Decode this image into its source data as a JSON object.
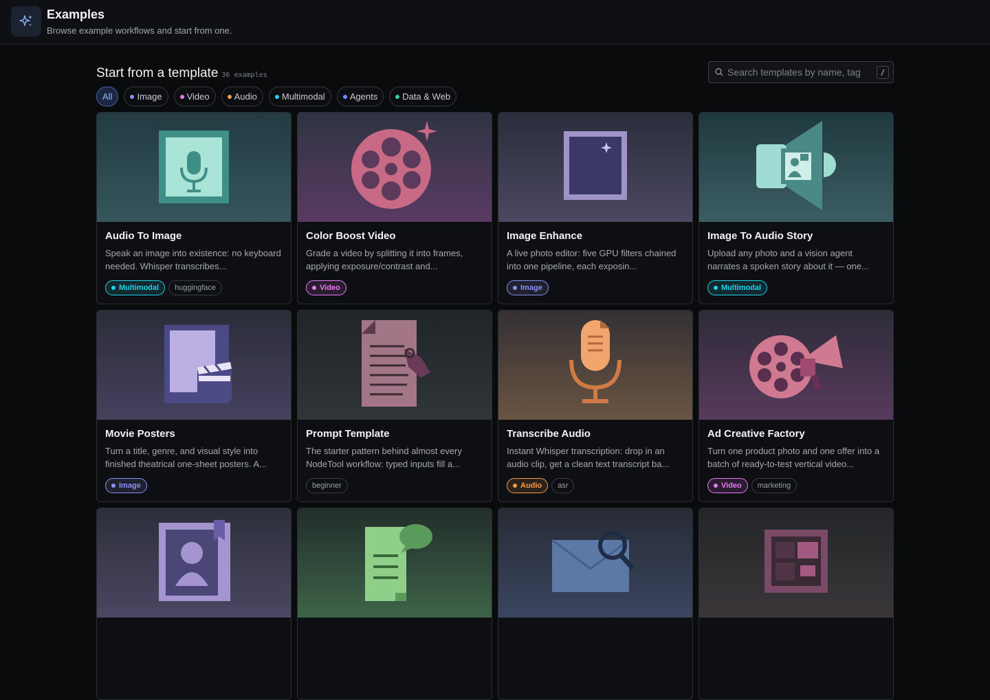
{
  "header": {
    "title": "Examples",
    "subtitle": "Browse example workflows and start from one."
  },
  "section": {
    "title": "Start from a template",
    "count": "36 examples"
  },
  "search": {
    "placeholder": "Search templates by name, tag",
    "shortcut": "/"
  },
  "filters": [
    {
      "label": "All",
      "color": ""
    },
    {
      "label": "Image",
      "color": "#8b8ef5"
    },
    {
      "label": "Video",
      "color": "#e879f9"
    },
    {
      "label": "Audio",
      "color": "#f59e4a"
    },
    {
      "label": "Multimodal",
      "color": "#22d3ee"
    },
    {
      "label": "Agents",
      "color": "#6b8cff"
    },
    {
      "label": "Data & Web",
      "color": "#34d399"
    }
  ],
  "templates": [
    {
      "title": "Audio To Image",
      "description": "Speak an image into existence: no keyboard needed. Whisper transcribes...",
      "category": "Multimodal",
      "tags": [
        "huggingface"
      ],
      "icon": "microphone-image-icon"
    },
    {
      "title": "Color Boost Video",
      "description": "Grade a video by splitting it into frames, applying exposure/contrast and...",
      "category": "Video",
      "tags": [],
      "icon": "film-reel-icon"
    },
    {
      "title": "Image Enhance",
      "description": "A live photo editor: five GPU filters chained into one pipeline, each exposin...",
      "category": "Image",
      "tags": [],
      "icon": "photo-frame-icon"
    },
    {
      "title": "Image To Audio Story",
      "description": "Upload any photo and a vision agent narrates a spoken story about it — one...",
      "category": "Multimodal",
      "tags": [],
      "icon": "speaker-photo-icon"
    },
    {
      "title": "Movie Posters",
      "description": "Turn a title, genre, and visual style into finished theatrical one-sheet posters. A...",
      "category": "Image",
      "tags": [],
      "icon": "poster-clapperboard-icon"
    },
    {
      "title": "Prompt Template",
      "description": "The starter pattern behind almost every NodeTool workflow: typed inputs fill a...",
      "category": "",
      "tags": [
        "beginner"
      ],
      "icon": "document-tag-icon"
    },
    {
      "title": "Transcribe Audio",
      "description": "Instant Whisper transcription: drop in an audio clip, get a clean text transcript ba...",
      "category": "Audio",
      "tags": [
        "asr"
      ],
      "icon": "microphone-transcript-icon"
    },
    {
      "title": "Ad Creative Factory",
      "description": "Turn one product photo and one offer into a batch of ready-to-test vertical video...",
      "category": "Video",
      "tags": [
        "marketing"
      ],
      "icon": "reel-megaphone-icon"
    },
    {
      "title": "",
      "description": "",
      "category": "",
      "tags": [],
      "icon": "portrait-bookmark-icon"
    },
    {
      "title": "",
      "description": "",
      "category": "",
      "tags": [],
      "icon": "document-chat-icon"
    },
    {
      "title": "",
      "description": "",
      "category": "",
      "tags": [],
      "icon": "envelope-search-icon"
    },
    {
      "title": "",
      "description": "",
      "category": "",
      "tags": [],
      "icon": "layout-frame-icon"
    }
  ],
  "category_colors": {
    "Multimodal": "#22d3ee",
    "Video": "#e879f9",
    "Image": "#8b8ef5",
    "Audio": "#f59e4a"
  }
}
